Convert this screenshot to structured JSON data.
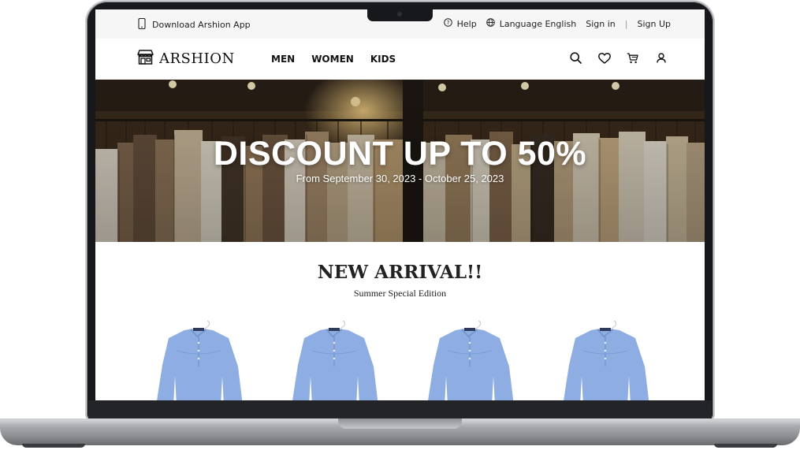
{
  "topbar": {
    "download_app": "Download Arshion App",
    "help": "Help",
    "language": "Language English",
    "sign_in": "Sign in",
    "separator": "|",
    "sign_up": "Sign Up"
  },
  "nav": {
    "brand": "ARSHION",
    "menu": [
      "MEN",
      "WOMEN",
      "KIDS"
    ],
    "icons": [
      "search-icon",
      "heart-icon",
      "cart-icon",
      "user-icon"
    ]
  },
  "hero": {
    "title": "DISCOUNT UP TO 50%",
    "subtitle": "From September 30, 2023 - October 25, 2023"
  },
  "new_arrival": {
    "title": "NEW ARRIVAL!!",
    "subtitle": "Summer Special Edition",
    "products": [
      {
        "name": "blue-linen-shirt"
      },
      {
        "name": "blue-linen-shirt"
      },
      {
        "name": "blue-linen-shirt"
      },
      {
        "name": "blue-linen-shirt"
      }
    ]
  },
  "colors": {
    "topbar_bg": "#f6f6f6",
    "text": "#111111",
    "shirt_blue": "#8eaee3",
    "laptop_frame": "#17181b"
  }
}
